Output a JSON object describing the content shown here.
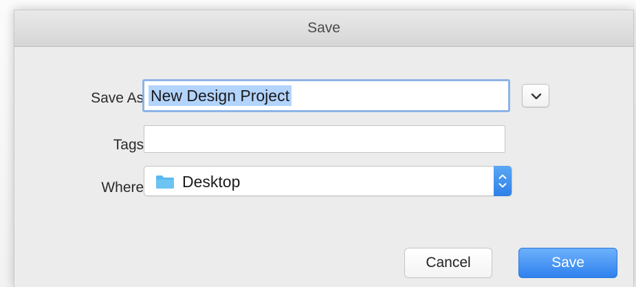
{
  "dialog": {
    "title": "Save"
  },
  "save_as": {
    "label": "Save As:",
    "value": "New Design Project"
  },
  "tags": {
    "label": "Tags:",
    "value": ""
  },
  "where": {
    "label": "Where:",
    "value": "Desktop",
    "icon": "folder-icon"
  },
  "buttons": {
    "cancel": "Cancel",
    "save": "Save"
  },
  "colors": {
    "accent": "#2f81ee",
    "selection": "#b3d4fc",
    "focus_ring": "#8cb3e6",
    "folder": "#5bb8ef"
  }
}
